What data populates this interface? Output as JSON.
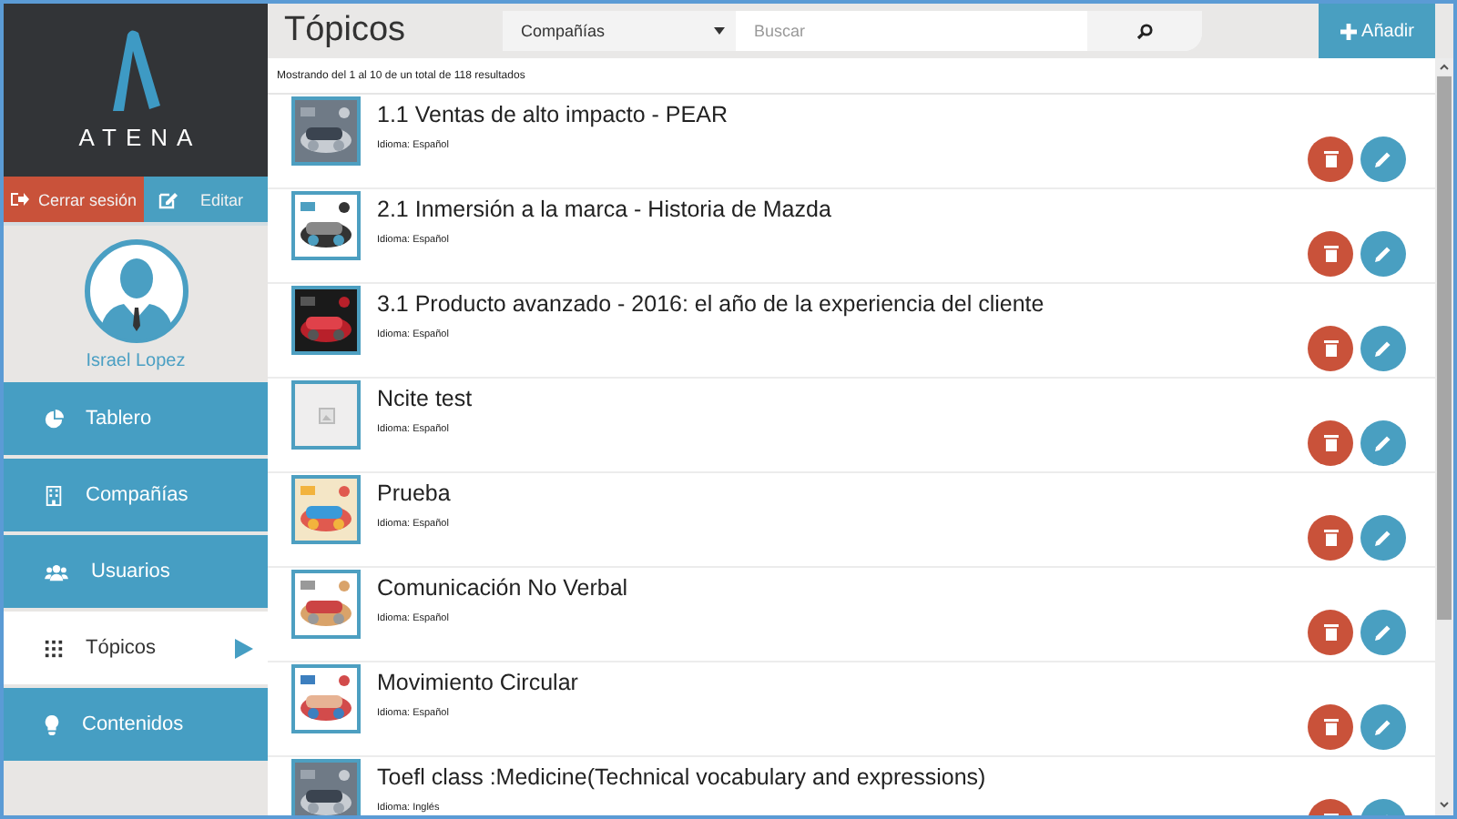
{
  "brand": {
    "name": "ATENA"
  },
  "session": {
    "logout": "Cerrar sesión",
    "edit": "Editar"
  },
  "user": {
    "name": "Israel Lopez"
  },
  "nav": [
    {
      "label": "Tablero",
      "kind": "dashboard",
      "selected": false
    },
    {
      "label": "Compañías",
      "kind": "companies",
      "selected": false
    },
    {
      "label": "Usuarios",
      "kind": "users",
      "selected": false
    },
    {
      "label": "Tópicos",
      "kind": "topics",
      "selected": true
    },
    {
      "label": "Contenidos",
      "kind": "contents",
      "selected": false
    }
  ],
  "header": {
    "title": "Tópicos",
    "filter": "Compañías",
    "search": {
      "placeholder": "Buscar"
    },
    "add": "Añadir"
  },
  "summary": "Mostrando del 1 al 10 de un total de 118 resultados",
  "rows": [
    {
      "title": "1.1 Ventas de alto impacto - PEAR",
      "language": "Idioma: Español"
    },
    {
      "title": "2.1 Inmersión a la marca - Historia de Mazda",
      "language": "Idioma: Español"
    },
    {
      "title": "3.1 Producto avanzado - 2016: el año de la experiencia del cliente",
      "language": "Idioma: Español"
    },
    {
      "title": "Ncite test",
      "language": "Idioma: Español",
      "thumbnail": {
        "kind": "placeholder"
      }
    },
    {
      "title": "Prueba",
      "language": "Idioma: Español"
    },
    {
      "title": "Comunicación No Verbal",
      "language": "Idioma: Español"
    },
    {
      "title": "Movimiento Circular",
      "language": "Idioma: Español"
    },
    {
      "title": "Toefl class :Medicine(Technical vocabulary and expressions)",
      "language": "Idioma: Inglés"
    }
  ]
}
